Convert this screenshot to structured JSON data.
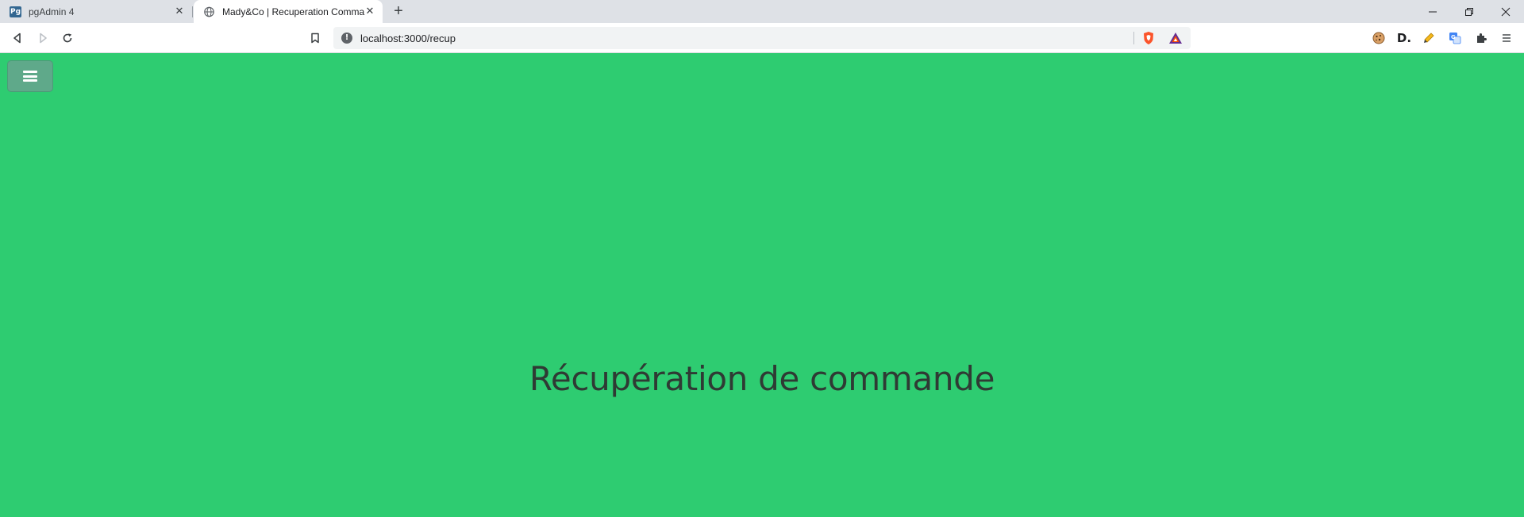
{
  "browser": {
    "tabs": [
      {
        "title": "pgAdmin 4",
        "favicon": "pgadmin-icon",
        "favicon_text": "Pg",
        "active": false
      },
      {
        "title": "Mady&Co | Recuperation Comma",
        "favicon": "globe-icon",
        "active": true
      }
    ],
    "new_tab_label": "+",
    "url": "localhost:3000/recup",
    "extensions": [
      "cookie-icon",
      "d-extension-icon",
      "pencil-icon",
      "translate-icon",
      "puzzle-icon",
      "menu-icon"
    ],
    "ext_d_label": "D."
  },
  "page": {
    "background_color": "#2ecc71",
    "menu_toggle_color": "#5fa98a",
    "heading": "Récupération de commande"
  }
}
